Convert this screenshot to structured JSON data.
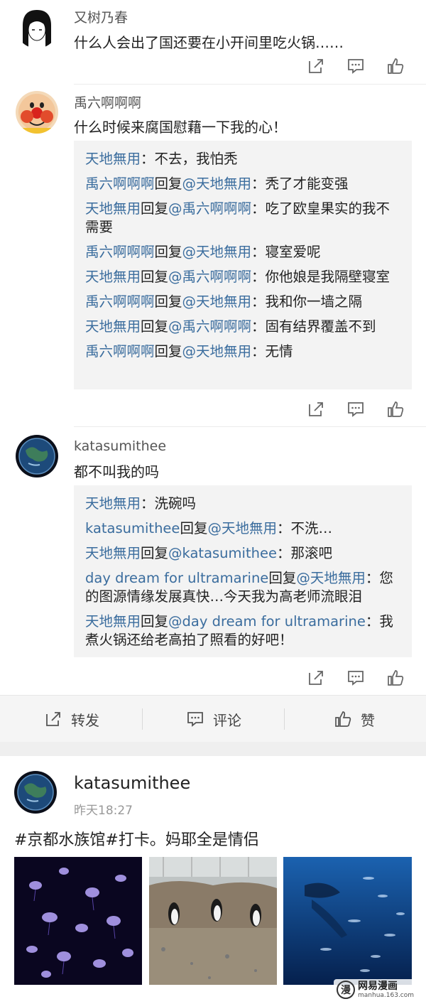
{
  "comments": [
    {
      "user": "又树乃春",
      "text": "什么人会出了国还要在小开间里吃火锅……"
    },
    {
      "user": "禹六啊啊啊",
      "text": "什么时候来腐国慰藉一下我的心！",
      "replies": [
        {
          "u1": "天地無用",
          "mid": "",
          "u2": "",
          "text": "：不去，我怕秃"
        },
        {
          "u1": "禹六啊啊啊",
          "mid": "回复",
          "u2": "@天地無用",
          "text": "：秃了才能变强"
        },
        {
          "u1": "天地無用",
          "mid": "回复",
          "u2": "@禹六啊啊啊",
          "text": "：吃了欧皇果实的我不需要"
        },
        {
          "u1": "禹六啊啊啊",
          "mid": "回复",
          "u2": "@天地無用",
          "text": "：寝室爱呢"
        },
        {
          "u1": "天地無用",
          "mid": "回复",
          "u2": "@禹六啊啊啊",
          "text": "：你他娘是我隔壁寝室"
        },
        {
          "u1": "禹六啊啊啊",
          "mid": "回复",
          "u2": "@天地無用",
          "text": "：我和你一墙之隔"
        },
        {
          "u1": "天地無用",
          "mid": "回复",
          "u2": "@禹六啊啊啊",
          "text": "：固有结界覆盖不到"
        },
        {
          "u1": "禹六啊啊啊",
          "mid": "回复",
          "u2": "@天地無用",
          "text": "：无情"
        }
      ]
    },
    {
      "user": "katasumithee",
      "text": "都不叫我的吗",
      "replies": [
        {
          "u1": "天地無用",
          "mid": "",
          "u2": "",
          "text": "：洗碗吗"
        },
        {
          "u1": "katasumithee",
          "mid": "回复",
          "u2": "@天地無用",
          "text": "：不洗…"
        },
        {
          "u1": "天地無用",
          "mid": "回复",
          "u2": "@katasumithee",
          "text": "：那滚吧"
        },
        {
          "u1": "day dream for ultramarine",
          "mid": "回复",
          "u2": "@天地無用",
          "text": "：您的图源情缘发展真快…今天我为高老师流眼泪"
        },
        {
          "u1": "天地無用",
          "mid": "回复",
          "u2": "@day dream for ultramarine",
          "text": "：我煮火锅还给老高拍了照看的好吧！"
        }
      ]
    }
  ],
  "bottom_bar": {
    "forward": "转发",
    "comment": "评论",
    "like": "赞"
  },
  "post": {
    "user": "katasumithee",
    "time": "昨天18:27",
    "text": "#京都水族馆#打卡。妈耶全是情侣"
  },
  "watermark": {
    "logo": "漫",
    "title": "网易漫画",
    "url": "manhua.163.com"
  },
  "colors": {
    "link": "#3b6d9e",
    "reply_bg": "#f3f3f3"
  }
}
